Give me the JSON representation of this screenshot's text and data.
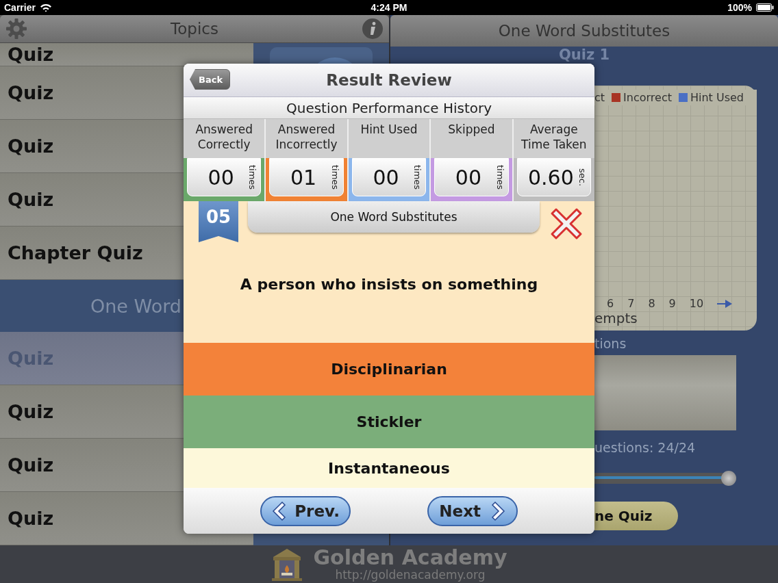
{
  "status_bar": {
    "carrier": "Carrier",
    "time": "4:24 PM",
    "battery": "100%"
  },
  "topics": {
    "title": "Topics",
    "items": [
      {
        "kind": "item",
        "label": "Quiz",
        "selected": false
      },
      {
        "kind": "item",
        "label": "Quiz",
        "selected": false
      },
      {
        "kind": "item",
        "label": "Quiz",
        "selected": false
      },
      {
        "kind": "item",
        "label": "Quiz",
        "selected": false
      },
      {
        "kind": "item",
        "label": "Chapter Quiz",
        "selected": false
      },
      {
        "kind": "section",
        "label": "One Word"
      },
      {
        "kind": "item",
        "label": "Quiz",
        "selected": true
      },
      {
        "kind": "item",
        "label": "Quiz",
        "selected": false
      },
      {
        "kind": "item",
        "label": "Quiz",
        "selected": false
      },
      {
        "kind": "item",
        "label": "Quiz",
        "selected": false
      }
    ]
  },
  "detail": {
    "title": "One Word Substitutes",
    "subtitle": "Quiz 1",
    "legend": [
      {
        "label": "ct"
      },
      {
        "label": "Incorrect",
        "color": "#a83424"
      },
      {
        "label": "Hint Used",
        "color": "#4a6fc4"
      }
    ],
    "axis_ticks": [
      "6",
      "7",
      "8",
      "9",
      "10"
    ],
    "axis_label": "empts",
    "section_label": "tions",
    "questions": "uestions: 24/24",
    "slider": {
      "level": 1
    },
    "start_button": "ne Quiz"
  },
  "modal": {
    "back": "Back",
    "title": "Result Review",
    "subtitle": "Question Performance History",
    "stats": [
      {
        "label": "Answered Correctly",
        "value": "00",
        "unit": "times",
        "color": "#6aa86a"
      },
      {
        "label": "Answered Incorrectly",
        "value": "01",
        "unit": "times",
        "color": "#f08234"
      },
      {
        "label": "Hint Used",
        "value": "00",
        "unit": "times",
        "color": "#8cb6ec"
      },
      {
        "label": "Skipped",
        "value": "00",
        "unit": "times",
        "color": "#c49ae2"
      },
      {
        "label": "Average Time Taken",
        "value": "0.60",
        "unit": "sec.",
        "color": "#bdbdbd"
      }
    ],
    "number": "05",
    "category": "One Word Substitutes",
    "answered_correctly": false,
    "question": "A person who insists on something",
    "options": [
      {
        "label": "Disciplinarian",
        "kind": "chosen"
      },
      {
        "label": "Stickler",
        "kind": "correct"
      },
      {
        "label": "Instantaneous",
        "kind": "plain"
      }
    ],
    "prev": "Prev.",
    "next": "Next"
  },
  "footer": {
    "brand": "Golden Academy",
    "url": "http://goldenacademy.org"
  }
}
